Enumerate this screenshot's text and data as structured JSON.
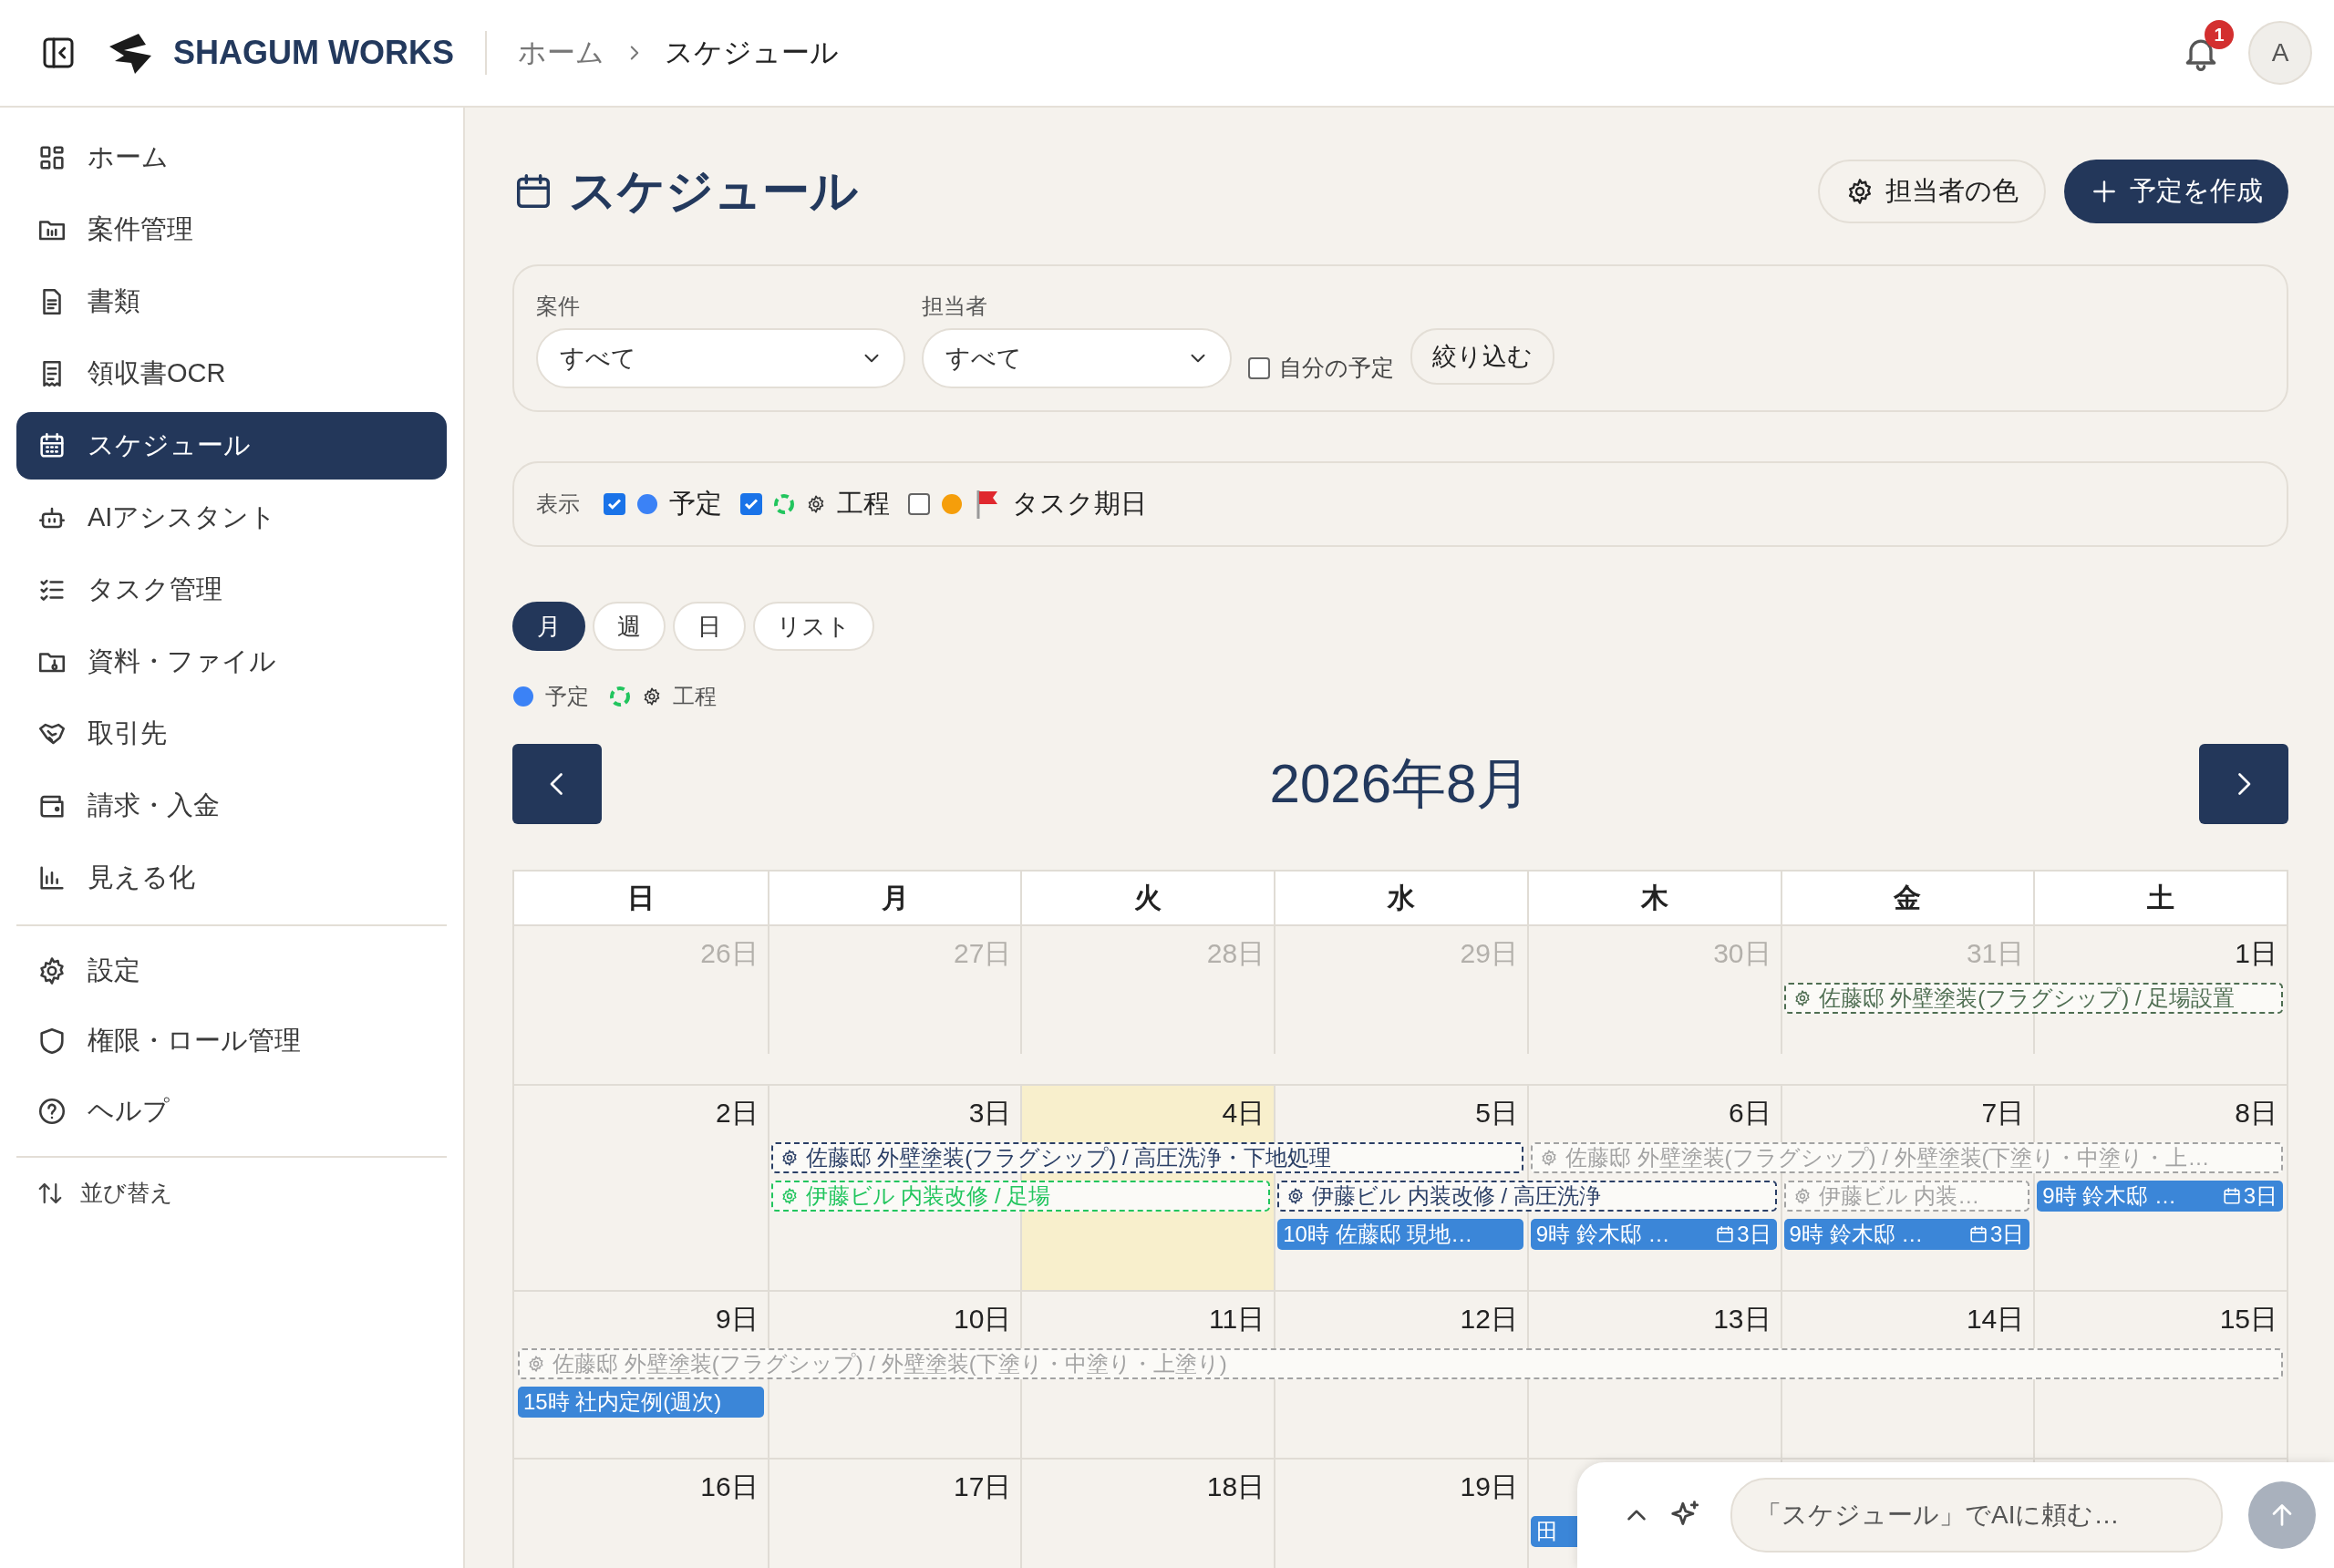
{
  "header": {
    "brand": "SHAGUM WORKS",
    "breadcrumb": [
      {
        "label": "ホーム",
        "current": false
      },
      {
        "label": "スケジュール",
        "current": true
      }
    ],
    "notifications": "1",
    "avatar": "A"
  },
  "sidebar": {
    "groups": [
      [
        {
          "label": "ホーム",
          "selected": false
        },
        {
          "label": "案件管理",
          "selected": false
        },
        {
          "label": "書類",
          "selected": false
        },
        {
          "label": "領収書OCR",
          "selected": false
        },
        {
          "label": "スケジュール",
          "selected": true
        },
        {
          "label": "AIアシスタント",
          "selected": false
        },
        {
          "label": "タスク管理",
          "selected": false
        },
        {
          "label": "資料・ファイル",
          "selected": false
        },
        {
          "label": "取引先",
          "selected": false
        },
        {
          "label": "請求・入金",
          "selected": false
        },
        {
          "label": "見える化",
          "selected": false
        }
      ],
      [
        {
          "label": "設定",
          "selected": false
        },
        {
          "label": "権限・ロール管理",
          "selected": false
        },
        {
          "label": "ヘルプ",
          "selected": false
        }
      ]
    ],
    "sort": "並び替え"
  },
  "page": {
    "title": "スケジュール",
    "actions": [
      {
        "label": "担当者の色",
        "kind": "secondary"
      },
      {
        "label": "予定を作成",
        "kind": "primary"
      }
    ]
  },
  "filters": {
    "fields": [
      {
        "label": "案件",
        "value": "すべて"
      },
      {
        "label": "担当者",
        "value": "すべて"
      }
    ],
    "mine": {
      "label": "自分の予定",
      "checked": false
    },
    "apply": "絞り込む"
  },
  "display": {
    "label": "表示",
    "options": [
      {
        "label": "予定",
        "checked": true,
        "kind": "dot",
        "color": "#3b82f6"
      },
      {
        "label": "工程",
        "checked": true,
        "kind": "process",
        "color": "#22c55e"
      },
      {
        "label": "タスク期日",
        "checked": false,
        "kind": "task",
        "color": "#f59e0b"
      }
    ]
  },
  "views": [
    {
      "label": "月",
      "selected": true
    },
    {
      "label": "週",
      "selected": false
    },
    {
      "label": "日",
      "selected": false
    },
    {
      "label": "リスト",
      "selected": false
    }
  ],
  "legend": [
    {
      "label": "予定",
      "kind": "dot",
      "color": "#3b82f6"
    },
    {
      "label": "工程",
      "kind": "process",
      "color": "#22c55e"
    }
  ],
  "calendar": {
    "month": "2026年8月",
    "weekdays": [
      "日",
      "月",
      "火",
      "水",
      "木",
      "金",
      "土"
    ],
    "weeks": [
      {
        "days": [
          {
            "label": "26日",
            "muted": true,
            "today": false
          },
          {
            "label": "27日",
            "muted": true,
            "today": false
          },
          {
            "label": "28日",
            "muted": true,
            "today": false
          },
          {
            "label": "29日",
            "muted": true,
            "today": false
          },
          {
            "label": "30日",
            "muted": true,
            "today": false
          },
          {
            "label": "31日",
            "muted": true,
            "today": false
          },
          {
            "label": "1日",
            "muted": false,
            "today": false
          }
        ],
        "lanes": [
          [
            {
              "kind": "gap"
            },
            {
              "kind": "gap"
            },
            {
              "kind": "gap"
            },
            {
              "kind": "gap"
            },
            {
              "kind": "gap"
            },
            {
              "kind": "process",
              "text": "佐藤邸 外壁塗装(フラグシップ) / 足場設置",
              "color": "#4f6e52"
            },
            {
              "kind": "continued"
            }
          ]
        ]
      },
      {
        "days": [
          {
            "label": "2日",
            "muted": false,
            "today": false
          },
          {
            "label": "3日",
            "muted": false,
            "today": false
          },
          {
            "label": "4日",
            "muted": false,
            "today": true
          },
          {
            "label": "5日",
            "muted": false,
            "today": false
          },
          {
            "label": "6日",
            "muted": false,
            "today": false
          },
          {
            "label": "7日",
            "muted": false,
            "today": false
          },
          {
            "label": "8日",
            "muted": false,
            "today": false
          }
        ],
        "lanes": [
          [
            {
              "kind": "gap"
            },
            {
              "kind": "process",
              "text": "佐藤邸 外壁塗装(フラグシップ) / 高圧洗浄・下地処理",
              "color": "#2b3f66"
            },
            {
              "kind": "continued"
            },
            {
              "kind": "continued"
            },
            {
              "kind": "process",
              "text": "佐藤邸 外壁塗装(フラグシップ) / 外壁塗装(下塗り・中塗り・上…",
              "color": "#a3a3a3"
            },
            {
              "kind": "continued"
            },
            {
              "kind": "continued"
            }
          ],
          [
            {
              "kind": "gap"
            },
            {
              "kind": "process",
              "text": "伊藤ビル 内装改修 / 足場",
              "color": "#22c55e"
            },
            {
              "kind": "continued"
            },
            {
              "kind": "process",
              "text": "伊藤ビル 内装改修 / 高圧洗浄",
              "color": "#2b3f66"
            },
            {
              "kind": "continued"
            },
            {
              "kind": "process",
              "text": "伊藤ビル 内装…",
              "color": "#a3a3a3"
            },
            {
              "kind": "appointment",
              "text": "9時 鈴木邸 …",
              "badge": "3日"
            }
          ],
          [
            {
              "kind": "gap"
            },
            {
              "kind": "gap"
            },
            {
              "kind": "gap"
            },
            {
              "kind": "appointment",
              "text": "10時 佐藤邸 現地…"
            },
            {
              "kind": "appointment",
              "text": "9時 鈴木邸 …",
              "badge": "3日"
            },
            {
              "kind": "appointment",
              "text": "9時 鈴木邸 …",
              "badge": "3日"
            },
            {
              "kind": "gap"
            }
          ]
        ]
      },
      {
        "days": [
          {
            "label": "9日",
            "muted": false,
            "today": false
          },
          {
            "label": "10日",
            "muted": false,
            "today": false
          },
          {
            "label": "11日",
            "muted": false,
            "today": false
          },
          {
            "label": "12日",
            "muted": false,
            "today": false
          },
          {
            "label": "13日",
            "muted": false,
            "today": false
          },
          {
            "label": "14日",
            "muted": false,
            "today": false
          },
          {
            "label": "15日",
            "muted": false,
            "today": false
          }
        ],
        "lanes": [
          [
            {
              "kind": "process",
              "text": "佐藤邸 外壁塗装(フラグシップ) / 外壁塗装(下塗り・中塗り・上塗り)",
              "color": "#a3a3a3"
            },
            {
              "kind": "continued"
            },
            {
              "kind": "continued"
            },
            {
              "kind": "continued"
            },
            {
              "kind": "continued"
            },
            {
              "kind": "continued"
            },
            {
              "kind": "continued"
            }
          ],
          [
            {
              "kind": "appointment",
              "text": "15時 社内定例(週次)"
            },
            {
              "kind": "gap"
            },
            {
              "kind": "gap"
            },
            {
              "kind": "gap"
            },
            {
              "kind": "gap"
            },
            {
              "kind": "gap"
            },
            {
              "kind": "gap"
            }
          ]
        ]
      },
      {
        "days": [
          {
            "label": "16日",
            "muted": false,
            "today": false
          },
          {
            "label": "17日",
            "muted": false,
            "today": false
          },
          {
            "label": "18日",
            "muted": false,
            "today": false
          },
          {
            "label": "19日",
            "muted": false,
            "today": false
          }
        ],
        "lanes": [
          [
            {
              "kind": "gap"
            },
            {
              "kind": "gap"
            },
            {
              "kind": "gap"
            },
            {
              "kind": "gap"
            },
            {
              "kind": "appointment",
              "text": "田"
            }
          ]
        ]
      }
    ]
  },
  "assistant": {
    "placeholder": "「スケジュール」でAIに頼む…"
  }
}
